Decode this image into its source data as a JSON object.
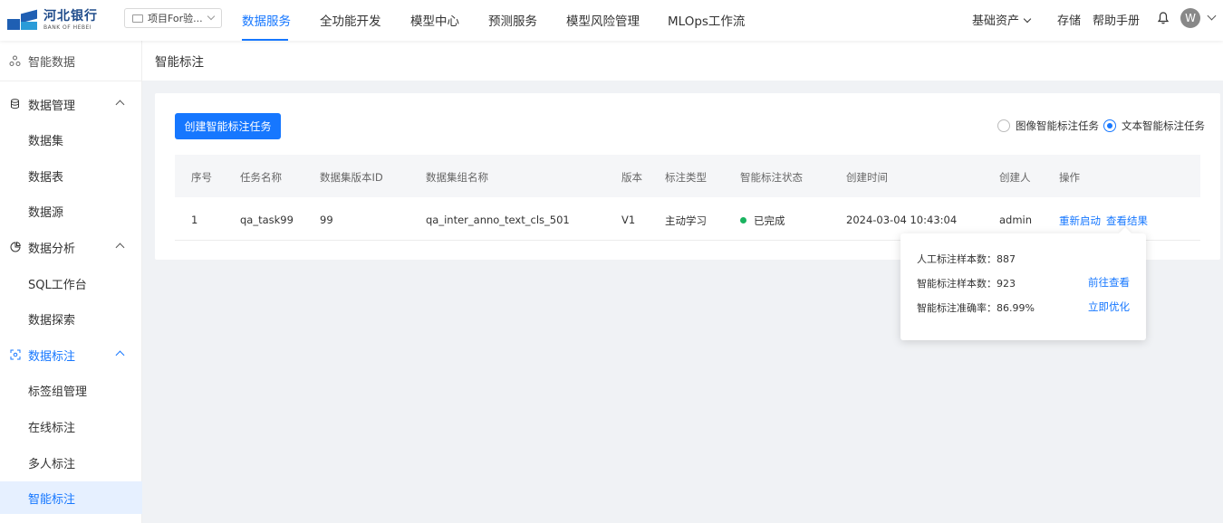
{
  "header": {
    "logo_cn": "河北银行",
    "logo_en": "BANK OF HEBEI",
    "project_selector": "项目For验...",
    "nav": [
      {
        "label": "数据服务",
        "active": true
      },
      {
        "label": "全功能开发",
        "active": false
      },
      {
        "label": "模型中心",
        "active": false
      },
      {
        "label": "预测服务",
        "active": false
      },
      {
        "label": "模型风险管理",
        "active": false
      },
      {
        "label": "MLOps工作流",
        "active": false
      }
    ],
    "right": {
      "assets": "基础资产",
      "storage": "存储",
      "help": "帮助手册",
      "avatar_letter": "W"
    }
  },
  "sidebar": {
    "top": "智能数据",
    "groups": [
      {
        "label": "数据管理",
        "icon": "database-icon",
        "items": [
          "数据集",
          "数据表",
          "数据源"
        ]
      },
      {
        "label": "数据分析",
        "icon": "chart-pie-icon",
        "items": [
          "SQL工作台",
          "数据探索"
        ]
      },
      {
        "label": "数据标注",
        "icon": "scan-icon",
        "items": [
          "标签组管理",
          "在线标注",
          "多人标注",
          "智能标注"
        ]
      }
    ],
    "active_item": "智能标注"
  },
  "page": {
    "breadcrumb": "智能标注",
    "create_button": "创建智能标注任务",
    "radio_image": "图像智能标注任务",
    "radio_text": "文本智能标注任务",
    "selected_radio": "text"
  },
  "table": {
    "columns": [
      "序号",
      "任务名称",
      "数据集版本ID",
      "数据集组名称",
      "版本",
      "标注类型",
      "智能标注状态",
      "创建时间",
      "创建人",
      "操作"
    ],
    "rows": [
      {
        "index": "1",
        "task_name": "qa_task99",
        "dataset_version_id": "99",
        "dataset_group": "qa_inter_anno_text_cls_501",
        "version": "V1",
        "annotation_type": "主动学习",
        "status": "已完成",
        "created_at": "2024-03-04 10:43:04",
        "creator": "admin",
        "action_restart": "重新启动",
        "action_view": "查看结果"
      }
    ]
  },
  "popover": {
    "manual_label": "人工标注样本数：",
    "manual_value": "887",
    "smart_label": "智能标注样本数：",
    "smart_value": "923",
    "accuracy_label": "智能标注准确率：",
    "accuracy_value": "86.99%",
    "goto_view": "前往查看",
    "optimize": "立即优化"
  },
  "colors": {
    "accent": "#1677ff",
    "status_done": "#19b35f"
  }
}
